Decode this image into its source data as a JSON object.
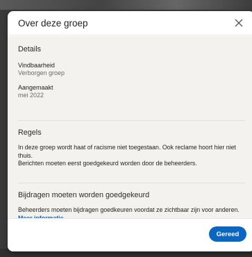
{
  "modal": {
    "title": "Over deze groep",
    "close_icon": "close-icon"
  },
  "details": {
    "heading": "Details",
    "findability_label": "Vindbaarheid",
    "findability_value": "Verborgen groep",
    "created_label": "Aangemaakt",
    "created_value": "mei 2022"
  },
  "rules": {
    "heading": "Regels",
    "line1": "In deze groep wordt haat of racisme niet toegestaan. Ook reclame hoort hier niet thuis.",
    "line2": "Berichten moeten eerst goedgekeurd worden door de beheerders."
  },
  "contributions": {
    "heading": "Bijdragen moeten worden goedgekeurd",
    "text": "Beheerders moeten bijdragen goedkeuren voordat ze zichtbaar zijn voor anderen.",
    "link": "Meer informatie"
  },
  "footer": {
    "done_label": "Gereed"
  },
  "colors": {
    "accent": "#0a66c2",
    "body_bg": "#f4f2ee"
  }
}
